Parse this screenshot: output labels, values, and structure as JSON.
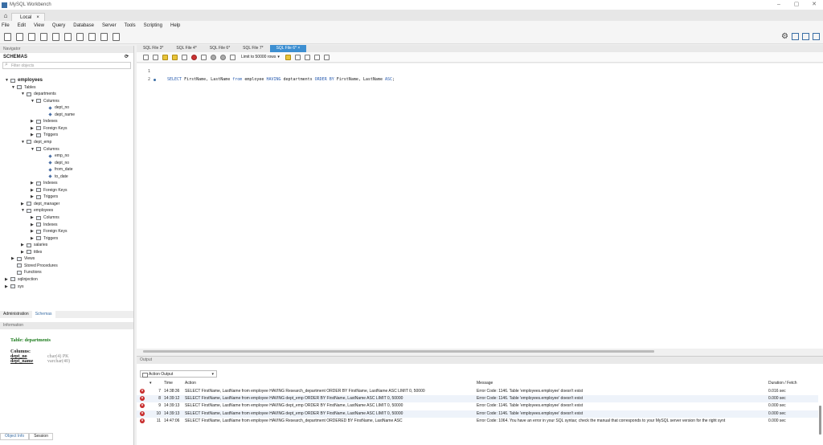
{
  "window": {
    "title": "MySQL Workbench",
    "min": "–",
    "max": "▢",
    "close": "✕"
  },
  "tabs": {
    "home_icon": "home-icon",
    "connection_tab": "Local",
    "connection_close": "×"
  },
  "menu": [
    "File",
    "Edit",
    "View",
    "Query",
    "Database",
    "Server",
    "Tools",
    "Scripting",
    "Help"
  ],
  "navigator": {
    "header": "Navigator",
    "schemas_label": "SCHEMAS",
    "schemas_refresh": "⟳",
    "filter_placeholder": "Filter objects",
    "tree": [
      {
        "label": "employees",
        "level": 0,
        "arrow": "▼",
        "icon": "db",
        "bold": true
      },
      {
        "label": "Tables",
        "level": 1,
        "arrow": "▼",
        "icon": "folder"
      },
      {
        "label": "departments",
        "level": 2,
        "arrow": "▼",
        "icon": "table"
      },
      {
        "label": "Columns",
        "level": 3,
        "arrow": "▼",
        "icon": "folder"
      },
      {
        "label": "dept_no",
        "level": 4,
        "arrow": "",
        "icon": "col"
      },
      {
        "label": "dept_name",
        "level": 4,
        "arrow": "",
        "icon": "col"
      },
      {
        "label": "Indexes",
        "level": 3,
        "arrow": "▶",
        "icon": "folder"
      },
      {
        "label": "Foreign Keys",
        "level": 3,
        "arrow": "▶",
        "icon": "folder"
      },
      {
        "label": "Triggers",
        "level": 3,
        "arrow": "▶",
        "icon": "folder"
      },
      {
        "label": "dept_emp",
        "level": 2,
        "arrow": "▼",
        "icon": "table"
      },
      {
        "label": "Columns",
        "level": 3,
        "arrow": "▼",
        "icon": "folder"
      },
      {
        "label": "emp_no",
        "level": 4,
        "arrow": "",
        "icon": "col"
      },
      {
        "label": "dept_no",
        "level": 4,
        "arrow": "",
        "icon": "col"
      },
      {
        "label": "from_date",
        "level": 4,
        "arrow": "",
        "icon": "col"
      },
      {
        "label": "to_date",
        "level": 4,
        "arrow": "",
        "icon": "col"
      },
      {
        "label": "Indexes",
        "level": 3,
        "arrow": "▶",
        "icon": "folder"
      },
      {
        "label": "Foreign Keys",
        "level": 3,
        "arrow": "▶",
        "icon": "folder"
      },
      {
        "label": "Triggers",
        "level": 3,
        "arrow": "▶",
        "icon": "folder"
      },
      {
        "label": "dept_manager",
        "level": 2,
        "arrow": "▶",
        "icon": "table"
      },
      {
        "label": "employees",
        "level": 2,
        "arrow": "▼",
        "icon": "table"
      },
      {
        "label": "Columns",
        "level": 3,
        "arrow": "▶",
        "icon": "folder"
      },
      {
        "label": "Indexes",
        "level": 3,
        "arrow": "▶",
        "icon": "folder"
      },
      {
        "label": "Foreign Keys",
        "level": 3,
        "arrow": "▶",
        "icon": "folder"
      },
      {
        "label": "Triggers",
        "level": 3,
        "arrow": "▶",
        "icon": "folder"
      },
      {
        "label": "salaries",
        "level": 2,
        "arrow": "▶",
        "icon": "table"
      },
      {
        "label": "titles",
        "level": 2,
        "arrow": "▶",
        "icon": "table"
      },
      {
        "label": "Views",
        "level": 1,
        "arrow": "▶",
        "icon": "folder"
      },
      {
        "label": "Stored Procedures",
        "level": 1,
        "arrow": "",
        "icon": "folder"
      },
      {
        "label": "Functions",
        "level": 1,
        "arrow": "",
        "icon": "folder"
      },
      {
        "label": "sqlinjection",
        "level": 0,
        "arrow": "▶",
        "icon": "db"
      },
      {
        "label": "sys",
        "level": 0,
        "arrow": "▶",
        "icon": "db"
      }
    ],
    "bottom_tabs": [
      "Administration",
      "Schemas"
    ],
    "info_header": "Information",
    "info": {
      "table_label": "Table: departments",
      "columns_label": "Columns:",
      "columns": [
        {
          "name": "dept_no",
          "type": "char(4) PK"
        },
        {
          "name": "dept_name",
          "type": "varchar(40)"
        }
      ]
    },
    "status_tabs": [
      "Object Info",
      "Session"
    ]
  },
  "editor": {
    "tabs": [
      "SQL File 3*",
      "SQL File 4*",
      "SQL File 6*",
      "SQL File 7*",
      "SQL File 6* ×"
    ],
    "active_tab_index": 4,
    "limit_label": "Limit to 50000 rows",
    "limit_dropdown": "▾",
    "lines": [
      {
        "num": "1",
        "dot": false,
        "tokens": []
      },
      {
        "num": "2",
        "dot": true,
        "tokens": [
          {
            "t": "SELECT",
            "k": true
          },
          {
            "t": " FirstName, LastName ",
            "k": false
          },
          {
            "t": "from",
            "k": true
          },
          {
            "t": " employee ",
            "k": false
          },
          {
            "t": "HAVING",
            "k": true
          },
          {
            "t": " deptartments ",
            "k": false
          },
          {
            "t": "ORDER BY",
            "k": true
          },
          {
            "t": " FirstName, LastName ",
            "k": false
          },
          {
            "t": "ASC",
            "k": true
          },
          {
            "t": ";",
            "k": false
          }
        ]
      }
    ]
  },
  "output": {
    "header": "Output",
    "selector": "Action Output",
    "selector_arrow": "▾",
    "columns": {
      "sort": "▾",
      "num": "#",
      "time": "Time",
      "action": "Action",
      "message": "Message",
      "duration": "Duration / Fetch"
    },
    "rows": [
      {
        "num": "7",
        "time": "14:38:36",
        "action": "SELECT FirstName, LastName from employee HAVING Research_department ORDER BY FirstName, LastName ASC LIMIT 0, 50000",
        "message": "Error Code: 1146. Table 'employees.employee' doesn't exist",
        "duration": "0.016 sec"
      },
      {
        "num": "8",
        "time": "14:39:12",
        "action": "SELECT FirstName, LastName from employee HAVING dept_emp ORDER BY FirstName, LastName ASC LIMIT 0, 50000",
        "message": "Error Code: 1146. Table 'employees.employee' doesn't exist",
        "duration": "0.000 sec"
      },
      {
        "num": "9",
        "time": "14:39:13",
        "action": "SELECT FirstName, LastName from employee HAVING dept_emp ORDER BY FirstName, LastName ASC LIMIT 0, 50000",
        "message": "Error Code: 1146. Table 'employees.employee' doesn't exist",
        "duration": "0.000 sec"
      },
      {
        "num": "10",
        "time": "14:39:13",
        "action": "SELECT FirstName, LastName from employee HAVING dept_emp ORDER BY FirstName, LastName ASC LIMIT 0, 50000",
        "message": "Error Code: 1146. Table 'employees.employee' doesn't exist",
        "duration": "0.000 sec"
      },
      {
        "num": "11",
        "time": "14:47:06",
        "action": "SELECT FirstName, LastName from employee HAVING Research_department ORDERED BY FirstName, LastName  ASC",
        "message": "Error Code: 1064. You have an error in your SQL syntax; check the manual that corresponds to your MySQL server version for the right synt",
        "duration": "0.000 sec"
      }
    ]
  },
  "colors": {
    "accent": "#3d8fd1",
    "error": "#c62828",
    "keyword": "#2a5db0",
    "info_table": "#1a7a1a"
  }
}
